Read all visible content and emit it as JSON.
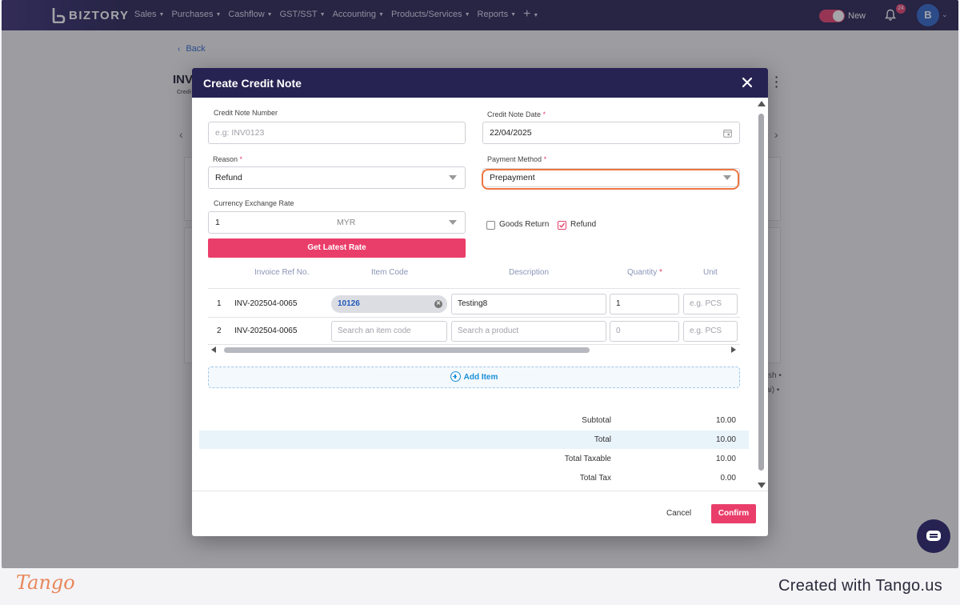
{
  "app": {
    "brand": "BIZTORY",
    "nav": [
      {
        "label": "Sales"
      },
      {
        "label": "Purchases"
      },
      {
        "label": "Cashflow"
      },
      {
        "label": "GST/SST"
      },
      {
        "label": "Accounting"
      },
      {
        "label": "Products/Services"
      },
      {
        "label": "Reports"
      }
    ],
    "nav_plus": "+",
    "toggle_label": "New",
    "notification_count": "24",
    "avatar_initial": "B",
    "accent_color": "#e6416d",
    "nav_bg_color": "#262252"
  },
  "page": {
    "back_label": "Back",
    "title_fragment": "INV",
    "subtitle_fragment": "Credi",
    "bg_fragment_1": "sh •",
    "bg_fragment_2": "ai) •"
  },
  "modal": {
    "title": "Create Credit Note",
    "credit_note_number": {
      "label": "Credit Note Number",
      "value": "",
      "placeholder": "e.g: INV0123"
    },
    "credit_note_date": {
      "label": "Credit Note Date",
      "required": "*",
      "value": "22/04/2025"
    },
    "reason": {
      "label": "Reason",
      "required": "*",
      "value": "Refund"
    },
    "payment_method": {
      "label": "Payment Method",
      "required": "*",
      "value": "Prepayment"
    },
    "currency_rate": {
      "label": "Currency Exchange Rate",
      "value": "1",
      "currency": "MYR"
    },
    "get_rate_button": "Get Latest Rate",
    "goods_return": {
      "label": "Goods Return",
      "checked": false
    },
    "refund": {
      "label": "Refund",
      "checked": true
    },
    "table": {
      "columns": [
        "Invoice Ref No.",
        "Item Code",
        "Description",
        "Quantity",
        "Unit"
      ],
      "quantity_required": "*",
      "rows": [
        {
          "no": "1",
          "invoice_ref": "INV-202504-0065",
          "item_code": "10126",
          "description": "Testing8",
          "quantity": "1",
          "unit_placeholder": "e.g. PCS"
        },
        {
          "no": "2",
          "invoice_ref": "INV-202504-0065",
          "item_code_placeholder": "Search an item code",
          "description_placeholder": "Search a product",
          "quantity_placeholder": "0",
          "unit_placeholder": "e.g. PCS"
        }
      ]
    },
    "add_item_label": "Add Item",
    "summary": [
      {
        "label": "Subtotal",
        "value": "10.00"
      },
      {
        "label": "Total",
        "value": "10.00"
      },
      {
        "label": "Total Taxable",
        "value": "10.00"
      },
      {
        "label": "Total Tax",
        "value": "0.00"
      }
    ],
    "cancel_label": "Cancel",
    "confirm_label": "Confirm"
  },
  "watermark": {
    "logo": "Tango",
    "credit": "Created with Tango.us"
  }
}
